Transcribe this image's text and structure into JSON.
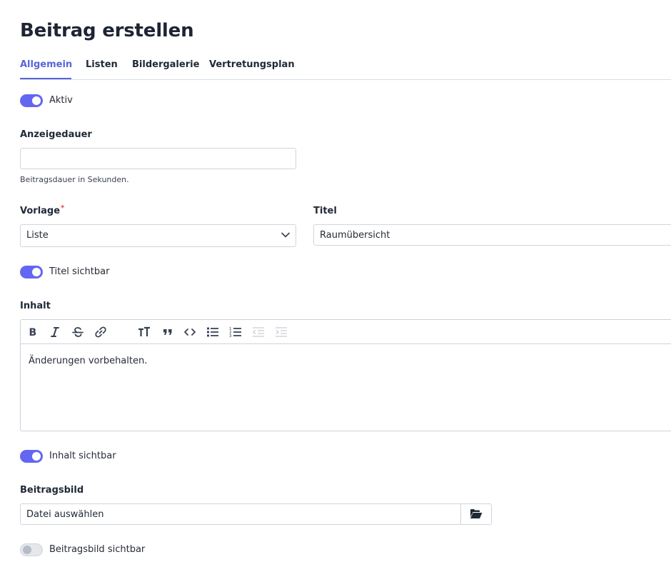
{
  "page": {
    "title": "Beitrag erstellen"
  },
  "tabs": [
    {
      "label": "Allgemein",
      "active": true
    },
    {
      "label": "Listen",
      "active": false
    },
    {
      "label": "Bildergalerie",
      "active": false
    },
    {
      "label": "Vertretungsplan",
      "active": false
    }
  ],
  "colors": {
    "accent": "#6366f1",
    "tab_active": "#5865d8",
    "required": "#e5484d"
  },
  "aktiv": {
    "label": "Aktiv",
    "checked": true
  },
  "anzeigedauer": {
    "label": "Anzeigedauer",
    "value": "",
    "hint": "Beitragsdauer in Sekunden."
  },
  "vorlage": {
    "label": "Vorlage",
    "required_marker": "*",
    "selected": "Liste",
    "icon": "chevron-down-icon"
  },
  "titel": {
    "label": "Titel",
    "value": "Raumübersicht"
  },
  "titel_sichtbar": {
    "label": "Titel sichtbar",
    "checked": true
  },
  "inhalt": {
    "label": "Inhalt",
    "content": "Änderungen vorbehalten.",
    "toolbar": [
      "bold-icon",
      "italic-icon",
      "strikethrough-icon",
      "link-icon",
      "heading-icon",
      "quote-icon",
      "code-icon",
      "bullet-list-icon",
      "numbered-list-icon",
      "decrease-indent-icon",
      "increase-indent-icon"
    ]
  },
  "inhalt_sichtbar": {
    "label": "Inhalt sichtbar",
    "checked": true
  },
  "beitragsbild": {
    "label": "Beitragsbild",
    "file_text": "Datei auswählen",
    "icon": "folder-open-icon"
  },
  "beitragsbild_sichtbar": {
    "label": "Beitragsbild sichtbar",
    "checked": false
  }
}
